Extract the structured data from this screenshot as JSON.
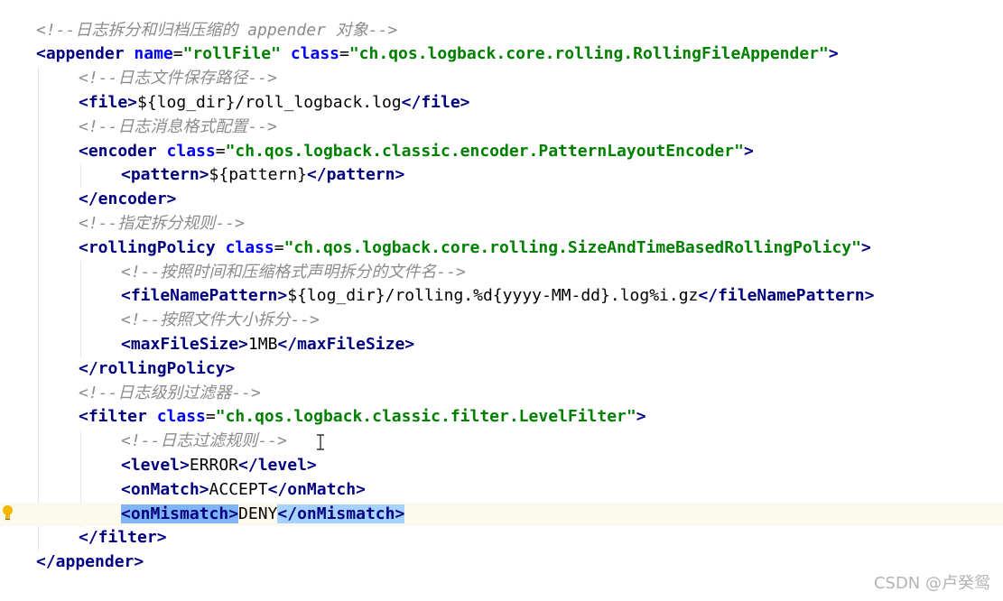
{
  "lines": [
    [
      {
        "t": "<!--日志拆分和归档压缩的 appender 对象-->",
        "c": "comment"
      }
    ],
    [
      {
        "t": "<appender",
        "c": "tag"
      },
      {
        "t": " ",
        "c": "text"
      },
      {
        "t": "name",
        "c": "attr"
      },
      {
        "t": "=",
        "c": "text"
      },
      {
        "t": "\"rollFile\"",
        "c": "str"
      },
      {
        "t": " ",
        "c": "text"
      },
      {
        "t": "class",
        "c": "attr"
      },
      {
        "t": "=",
        "c": "text"
      },
      {
        "t": "\"ch.qos.logback.core.rolling.RollingFileAppender\"",
        "c": "str"
      },
      {
        "t": ">",
        "c": "tag"
      }
    ],
    [
      {
        "t": "<!--日志文件保存路径-->",
        "c": "comment"
      }
    ],
    [
      {
        "t": "<file>",
        "c": "tag"
      },
      {
        "t": "${log_dir}/roll_logback.log",
        "c": "text"
      },
      {
        "t": "</file>",
        "c": "tag"
      }
    ],
    [
      {
        "t": "<!--日志消息格式配置-->",
        "c": "comment"
      }
    ],
    [
      {
        "t": "<encoder",
        "c": "tag"
      },
      {
        "t": " ",
        "c": "text"
      },
      {
        "t": "class",
        "c": "attr"
      },
      {
        "t": "=",
        "c": "text"
      },
      {
        "t": "\"ch.qos.logback.classic.encoder.PatternLayoutEncoder\"",
        "c": "str"
      },
      {
        "t": ">",
        "c": "tag"
      }
    ],
    [
      {
        "t": "<pattern>",
        "c": "tag"
      },
      {
        "t": "${pattern}",
        "c": "text"
      },
      {
        "t": "</pattern>",
        "c": "tag"
      }
    ],
    [
      {
        "t": "</encoder>",
        "c": "tag"
      }
    ],
    [
      {
        "t": "<!--指定拆分规则-->",
        "c": "comment"
      }
    ],
    [
      {
        "t": "<rollingPolicy",
        "c": "tag"
      },
      {
        "t": " ",
        "c": "text"
      },
      {
        "t": "class",
        "c": "attr"
      },
      {
        "t": "=",
        "c": "text"
      },
      {
        "t": "\"ch.qos.logback.core.rolling.SizeAndTimeBasedRollingPolicy\"",
        "c": "str"
      },
      {
        "t": ">",
        "c": "tag"
      }
    ],
    [
      {
        "t": "<!--按照时间和压缩格式声明拆分的文件名-->",
        "c": "comment"
      }
    ],
    [
      {
        "t": "<fileNamePattern>",
        "c": "tag"
      },
      {
        "t": "${log_dir}/rolling.%d{yyyy-MM-dd}.log%i.gz",
        "c": "text"
      },
      {
        "t": "</fileNamePattern>",
        "c": "tag"
      }
    ],
    [
      {
        "t": "<!--按照文件大小拆分-->",
        "c": "comment"
      }
    ],
    [
      {
        "t": "<maxFileSize>",
        "c": "tag"
      },
      {
        "t": "1MB",
        "c": "text"
      },
      {
        "t": "</maxFileSize>",
        "c": "tag"
      }
    ],
    [
      {
        "t": "</rollingPolicy>",
        "c": "tag"
      }
    ],
    [
      {
        "t": "<!--日志级别过滤器-->",
        "c": "comment"
      }
    ],
    [
      {
        "t": "<filter",
        "c": "tag"
      },
      {
        "t": " ",
        "c": "text"
      },
      {
        "t": "class",
        "c": "attr"
      },
      {
        "t": "=",
        "c": "text"
      },
      {
        "t": "\"ch.qos.logback.classic.filter.LevelFilter\"",
        "c": "str"
      },
      {
        "t": ">",
        "c": "tag"
      }
    ],
    [
      {
        "t": "<!--日志过滤规则-->",
        "c": "comment"
      }
    ],
    [
      {
        "t": "<level>",
        "c": "tag"
      },
      {
        "t": "ERROR",
        "c": "text"
      },
      {
        "t": "</level>",
        "c": "tag"
      }
    ],
    [
      {
        "t": "<onMatch>",
        "c": "tag"
      },
      {
        "t": "ACCEPT",
        "c": "text"
      },
      {
        "t": "</onMatch>",
        "c": "tag"
      }
    ],
    [
      {
        "t": "<onMismatch>",
        "c": "tag",
        "hl": "sel-strong"
      },
      {
        "t": "DENY",
        "c": "text"
      },
      {
        "t": "</onMismatch>",
        "c": "tag",
        "hl": "sel"
      }
    ],
    [
      {
        "t": "</filter>",
        "c": "tag"
      }
    ],
    [
      {
        "t": "</appender>",
        "c": "tag"
      }
    ]
  ],
  "active_line": 20,
  "watermark": "CSDN @卢癸鸳",
  "colors": {
    "comment": "#8c8c8c",
    "tag": "#000080",
    "attribute": "#0000ff",
    "string": "#008000",
    "selection": "#a6d2ff",
    "current_line": "#fcfaed"
  }
}
